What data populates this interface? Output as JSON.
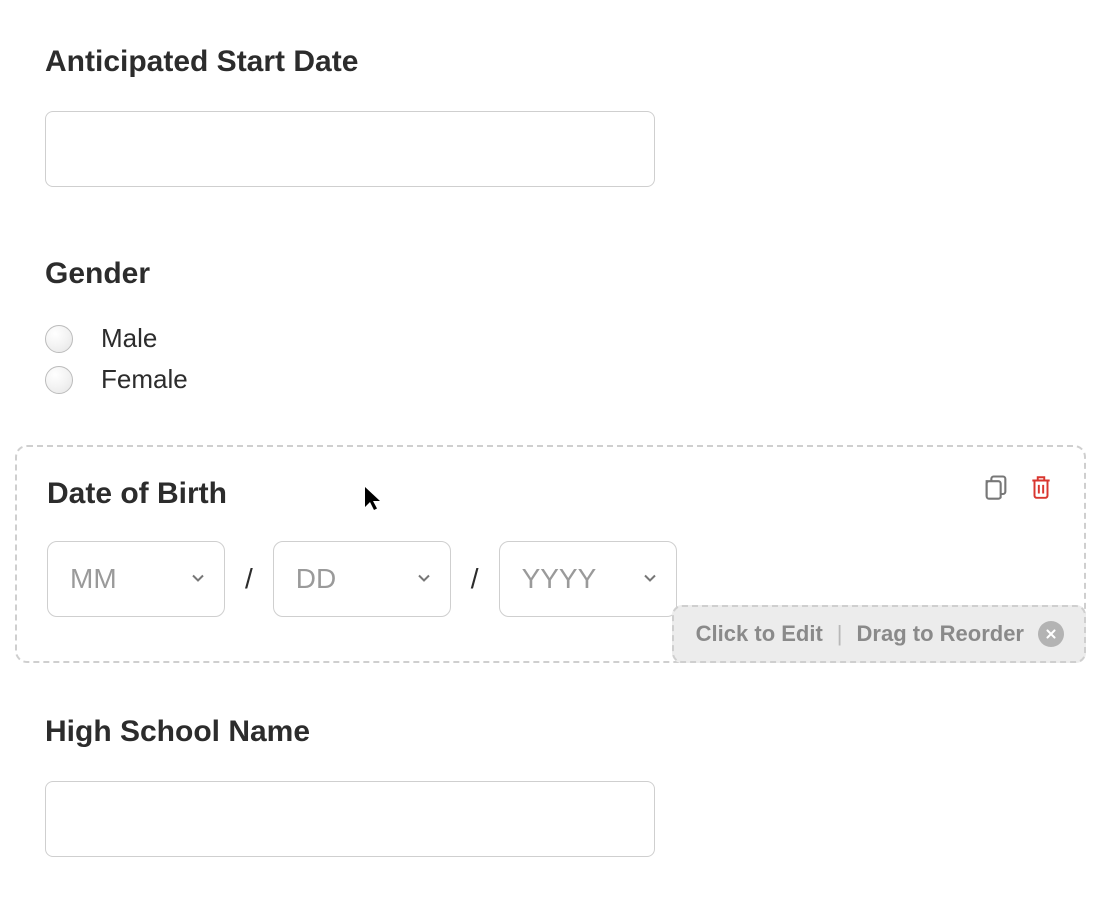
{
  "startDate": {
    "label": "Anticipated Start Date",
    "value": ""
  },
  "gender": {
    "label": "Gender",
    "options": [
      "Male",
      "Female"
    ]
  },
  "dob": {
    "label": "Date of Birth",
    "month_placeholder": "MM",
    "day_placeholder": "DD",
    "year_placeholder": "YYYY",
    "separator": "/"
  },
  "hint": {
    "edit": "Click to Edit",
    "reorder": "Drag to Reorder",
    "divider": "|"
  },
  "highSchool": {
    "label": "High School Name",
    "value": ""
  },
  "colors": {
    "danger": "#d9362f",
    "muted": "#8a8a8a"
  }
}
